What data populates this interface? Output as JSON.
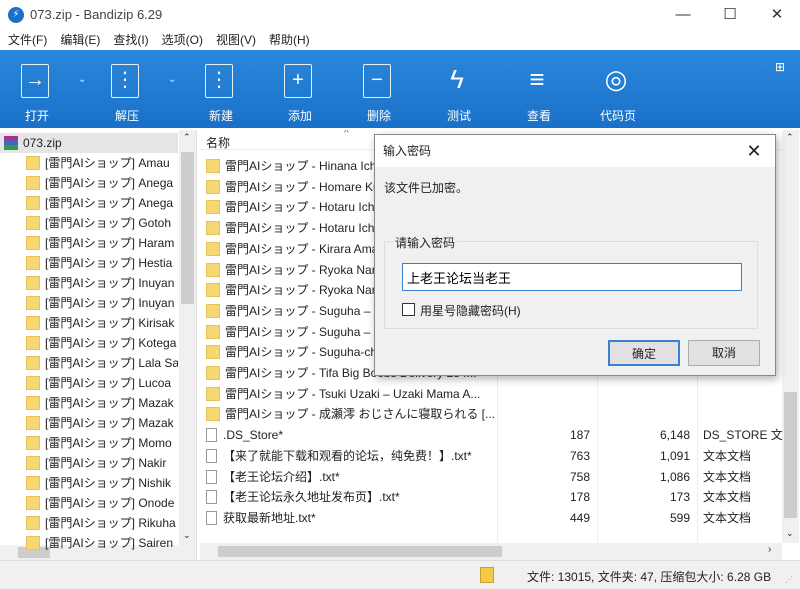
{
  "window": {
    "title": "073.zip - Bandizip 6.29",
    "min": "—",
    "max": "☐",
    "close": "✕"
  },
  "menu": [
    "文件(F)",
    "编辑(E)",
    "查找(I)",
    "选项(O)",
    "视图(V)",
    "帮助(H)"
  ],
  "toolbar": [
    {
      "label": "打开",
      "icon": "→"
    },
    {
      "label": "解压",
      "icon": "⋮"
    },
    {
      "label": "新建",
      "icon": "⋮"
    },
    {
      "label": "添加",
      "icon": "+"
    },
    {
      "label": "删除",
      "icon": "−"
    },
    {
      "label": "测试",
      "icon": "ϟ"
    },
    {
      "label": "查看",
      "icon": "≡"
    },
    {
      "label": "代码页",
      "icon": "◎"
    }
  ],
  "tree": {
    "root": "073.zip",
    "items": [
      "[雷門AIショップ] Amau",
      "[雷門AIショップ] Anega",
      "[雷門AIショップ] Anega",
      "[雷門AIショップ] Gotoh",
      "[雷門AIショップ] Haram",
      "[雷門AIショップ] Hestia",
      "[雷門AIショップ] Inuyan",
      "[雷門AIショップ] Inuyan",
      "[雷門AIショップ] Kirisak",
      "[雷門AIショップ] Kotega",
      "[雷門AIショップ] Lala Sa",
      "[雷門AIショップ] Lucoa",
      "[雷門AIショップ] Mazak",
      "[雷門AIショップ] Mazak",
      "[雷門AIショップ] Momo",
      "[雷門AIショップ] Nakir",
      "[雷門AIショップ] Nishik",
      "[雷門AIショップ] Onode",
      "[雷門AIショップ] Rikuha",
      "[雷門AIショップ] Sairen"
    ]
  },
  "list": {
    "header_name": "名称",
    "rows": [
      {
        "name": "雷門AIショップ - Hinana Ichinose",
        "type": "folder"
      },
      {
        "name": "雷門AIショップ - Homare Kurosaki",
        "type": "folder"
      },
      {
        "name": "雷門AIショップ - Hotaru Ichijo",
        "type": "folder"
      },
      {
        "name": "雷門AIショップ - Hotaru Ichijo",
        "type": "folder"
      },
      {
        "name": "雷門AIショップ - Kirara Amane",
        "type": "folder"
      },
      {
        "name": "雷門AIショップ - Ryoka Narusawa",
        "type": "folder"
      },
      {
        "name": "雷門AIショップ - Ryoka Narusawa",
        "type": "folder"
      },
      {
        "name": "雷門AIショップ - Suguha –",
        "type": "folder"
      },
      {
        "name": "雷門AIショップ - Suguha –",
        "type": "folder"
      },
      {
        "name": "雷門AIショップ - Suguha-chan",
        "type": "folder"
      },
      {
        "name": "雷門AIショップ - Tifa Big Boobs Delivery 284...",
        "type": "folder"
      },
      {
        "name": "雷門AIショップ - Tsuki Uzaki – Uzaki Mama A...",
        "type": "folder"
      },
      {
        "name": "雷門AIショップ - 成瀬澪 おじさんに寝取られる [...",
        "type": "folder"
      },
      {
        "name": ".DS_Store*",
        "type": "file",
        "packed": "187",
        "size": "6,148",
        "kind": "DS_STORE 文件"
      },
      {
        "name": "【来了就能下载和观看的论坛，纯免费！】.txt*",
        "type": "txt",
        "packed": "763",
        "size": "1,091",
        "kind": "文本文档"
      },
      {
        "name": "【老王论坛介绍】.txt*",
        "type": "txt",
        "packed": "758",
        "size": "1,086",
        "kind": "文本文档"
      },
      {
        "name": "【老王论坛永久地址发布页】.txt*",
        "type": "txt",
        "packed": "178",
        "size": "173",
        "kind": "文本文档"
      },
      {
        "name": "获取最新地址.txt*",
        "type": "txt",
        "packed": "449",
        "size": "599",
        "kind": "文本文档"
      }
    ]
  },
  "status": "文件: 13015, 文件夹: 47, 压缩包大小: 6.28 GB",
  "dialog": {
    "title": "输入密码",
    "message": "该文件已加密。",
    "group_label": "请输入密码",
    "password": "上老王论坛当老王",
    "checkbox": "用星号隐藏密码(H)",
    "checked": false,
    "ok": "确定",
    "cancel": "取消"
  }
}
